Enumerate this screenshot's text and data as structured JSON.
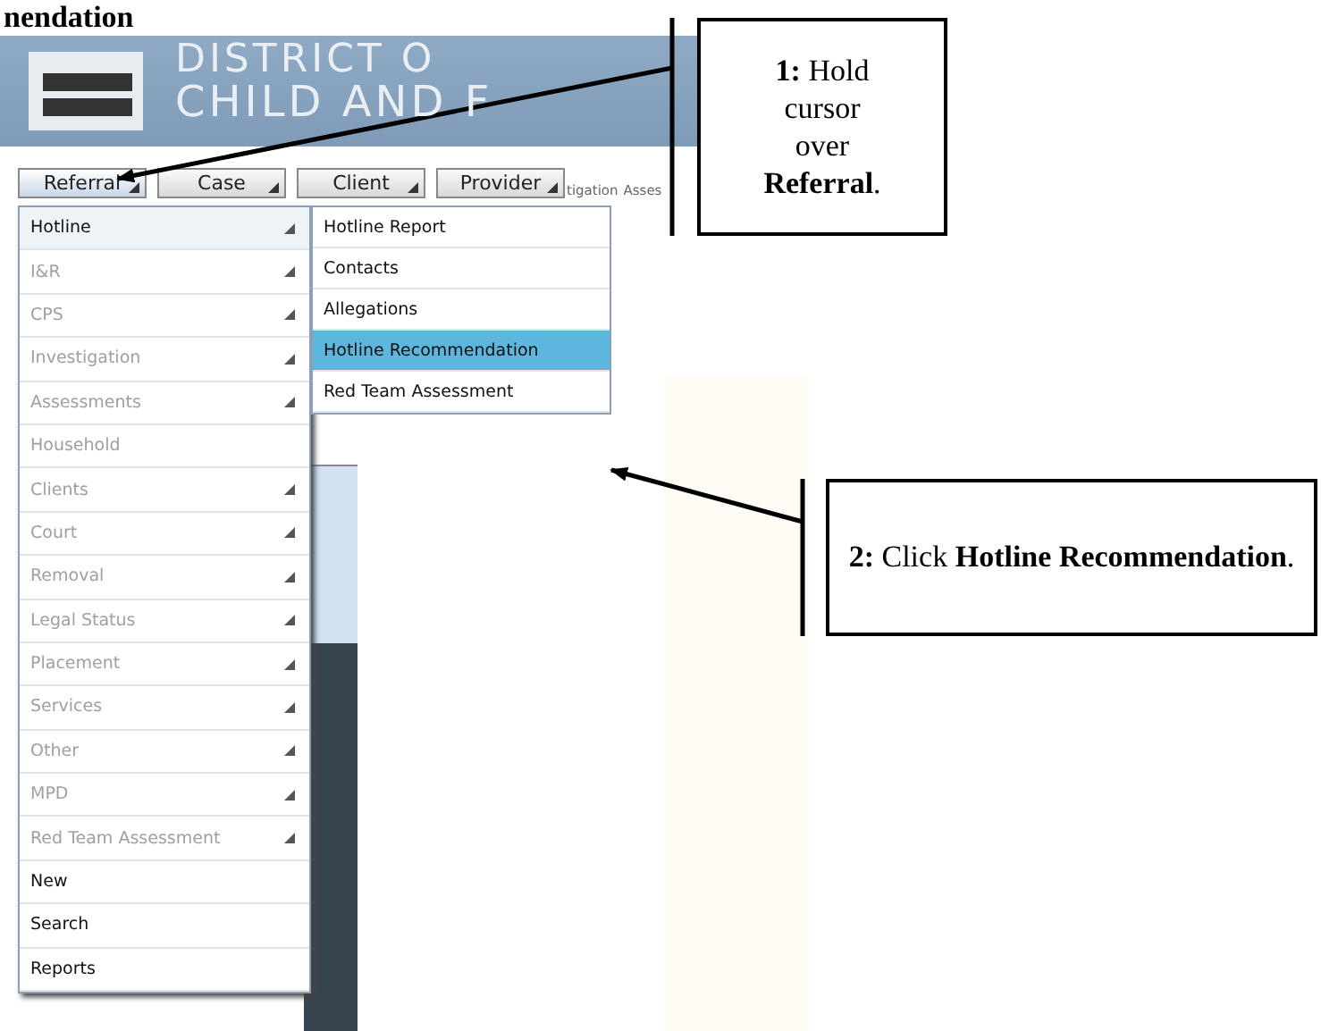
{
  "heading": "nendation",
  "banner": {
    "line_1": "DISTRICT O",
    "line_2": "CHILD AND F"
  },
  "tabs": [
    {
      "label": "Referral",
      "selected": true
    },
    {
      "label": "Case",
      "selected": false
    },
    {
      "label": "Client",
      "selected": false
    },
    {
      "label": "Provider",
      "selected": false
    }
  ],
  "breadcrumb": [
    "tigation",
    "Asses"
  ],
  "menu": {
    "items": [
      {
        "label": "Hotline",
        "enabled": true,
        "submenu": true,
        "selected": true
      },
      {
        "label": "I&R",
        "enabled": false,
        "submenu": true,
        "selected": false
      },
      {
        "label": "CPS",
        "enabled": false,
        "submenu": true,
        "selected": false
      },
      {
        "label": "Investigation",
        "enabled": false,
        "submenu": true,
        "selected": false
      },
      {
        "label": "Assessments",
        "enabled": false,
        "submenu": true,
        "selected": false
      },
      {
        "label": "Household",
        "enabled": false,
        "submenu": false,
        "selected": false
      },
      {
        "label": "Clients",
        "enabled": false,
        "submenu": true,
        "selected": false
      },
      {
        "label": "Court",
        "enabled": false,
        "submenu": true,
        "selected": false
      },
      {
        "label": "Removal",
        "enabled": false,
        "submenu": true,
        "selected": false
      },
      {
        "label": "Legal Status",
        "enabled": false,
        "submenu": true,
        "selected": false
      },
      {
        "label": "Placement",
        "enabled": false,
        "submenu": true,
        "selected": false
      },
      {
        "label": "Services",
        "enabled": false,
        "submenu": true,
        "selected": false
      },
      {
        "label": "Other",
        "enabled": false,
        "submenu": true,
        "selected": false
      },
      {
        "label": "MPD",
        "enabled": false,
        "submenu": true,
        "selected": false
      },
      {
        "label": "Red Team Assessment",
        "enabled": false,
        "submenu": true,
        "selected": false
      },
      {
        "label": "New",
        "enabled": true,
        "submenu": false,
        "selected": false
      },
      {
        "label": "Search",
        "enabled": true,
        "submenu": false,
        "selected": false
      },
      {
        "label": "Reports",
        "enabled": true,
        "submenu": false,
        "selected": false
      }
    ]
  },
  "submenu": {
    "items": [
      {
        "label": "Hotline Report",
        "selected": false
      },
      {
        "label": "Contacts",
        "selected": false
      },
      {
        "label": "Allegations",
        "selected": false
      },
      {
        "label": "Hotline Recommendation",
        "selected": true
      },
      {
        "label": "Red Team Assessment",
        "selected": false
      }
    ]
  },
  "callouts": [
    {
      "text": "**1:** Hold cursor over **Referral**."
    },
    {
      "text": "**2:** Click **Hotline Recommendation**."
    }
  ]
}
